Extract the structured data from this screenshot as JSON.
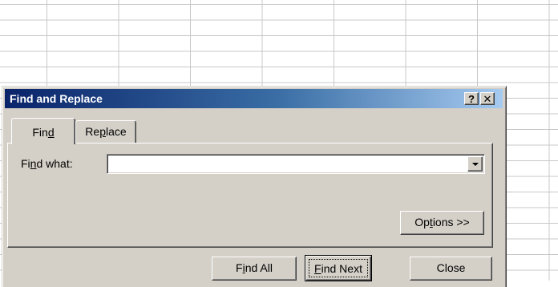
{
  "window": {
    "title": "Find and Replace",
    "help_label": "?",
    "close_label": "✕"
  },
  "tabs": [
    {
      "label_pre": "Fin",
      "label_mn": "d",
      "label_post": "",
      "active": true
    },
    {
      "label_pre": "Re",
      "label_mn": "p",
      "label_post": "lace",
      "active": false
    }
  ],
  "find_what": {
    "label_pre": "Fi",
    "label_mn": "n",
    "label_post": "d what:",
    "value": ""
  },
  "buttons": {
    "options": {
      "pre": "Op",
      "mn": "t",
      "post": "ions >>"
    },
    "find_all": {
      "pre": "F",
      "mn": "i",
      "post": "nd All"
    },
    "find_next": {
      "pre": "",
      "mn": "F",
      "post": "ind Next"
    },
    "close": {
      "label": "Close"
    }
  },
  "icons": {
    "dropdown": "chevron-down-icon",
    "close": "close-icon",
    "help": "help-icon"
  }
}
